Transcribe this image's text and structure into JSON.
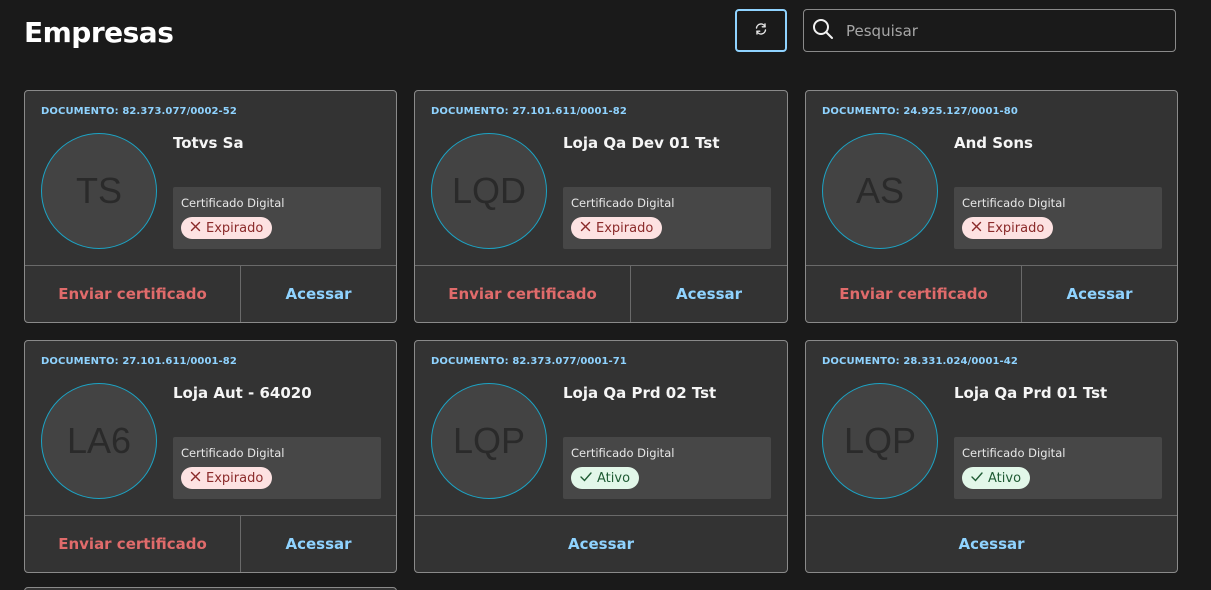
{
  "header": {
    "title": "Empresas",
    "refresh_icon": "refresh-icon",
    "search_placeholder": "Pesquisar",
    "search_value": "",
    "search_icon": "search-icon"
  },
  "colors": {
    "background": "#1a1a1a",
    "card": "#333333",
    "accent": "#8fd3ff",
    "danger": "#e06b6b",
    "avatar_ring": "#1ca3c4"
  },
  "companies": [
    {
      "document": "DOCUMENTO: 82.373.077/0002-52",
      "initials": "TS",
      "name": "Totvs Sa",
      "cert_label": "Certificado Digital",
      "status": "Expirado",
      "status_type": "expired",
      "send_label": "Enviar certificado",
      "access_label": "Acessar"
    },
    {
      "document": "DOCUMENTO: 27.101.611/0001-82",
      "initials": "LQD",
      "name": "Loja Qa Dev 01 Tst",
      "cert_label": "Certificado Digital",
      "status": "Expirado",
      "status_type": "expired",
      "send_label": "Enviar certificado",
      "access_label": "Acessar"
    },
    {
      "document": "DOCUMENTO: 24.925.127/0001-80",
      "initials": "AS",
      "name": "And Sons",
      "cert_label": "Certificado Digital",
      "status": "Expirado",
      "status_type": "expired",
      "send_label": "Enviar certificado",
      "access_label": "Acessar"
    },
    {
      "document": "DOCUMENTO: 27.101.611/0001-82",
      "initials": "LA6",
      "name": "Loja Aut - 64020",
      "cert_label": "Certificado Digital",
      "status": "Expirado",
      "status_type": "expired",
      "send_label": "Enviar certificado",
      "access_label": "Acessar"
    },
    {
      "document": "DOCUMENTO: 82.373.077/0001-71",
      "initials": "LQP",
      "name": "Loja Qa Prd 02 Tst",
      "cert_label": "Certificado Digital",
      "status": "Ativo",
      "status_type": "active",
      "send_label": "",
      "access_label": "Acessar"
    },
    {
      "document": "DOCUMENTO: 28.331.024/0001-42",
      "initials": "LQP",
      "name": "Loja Qa Prd 01 Tst",
      "cert_label": "Certificado Digital",
      "status": "Ativo",
      "status_type": "active",
      "send_label": "",
      "access_label": "Acessar"
    }
  ]
}
